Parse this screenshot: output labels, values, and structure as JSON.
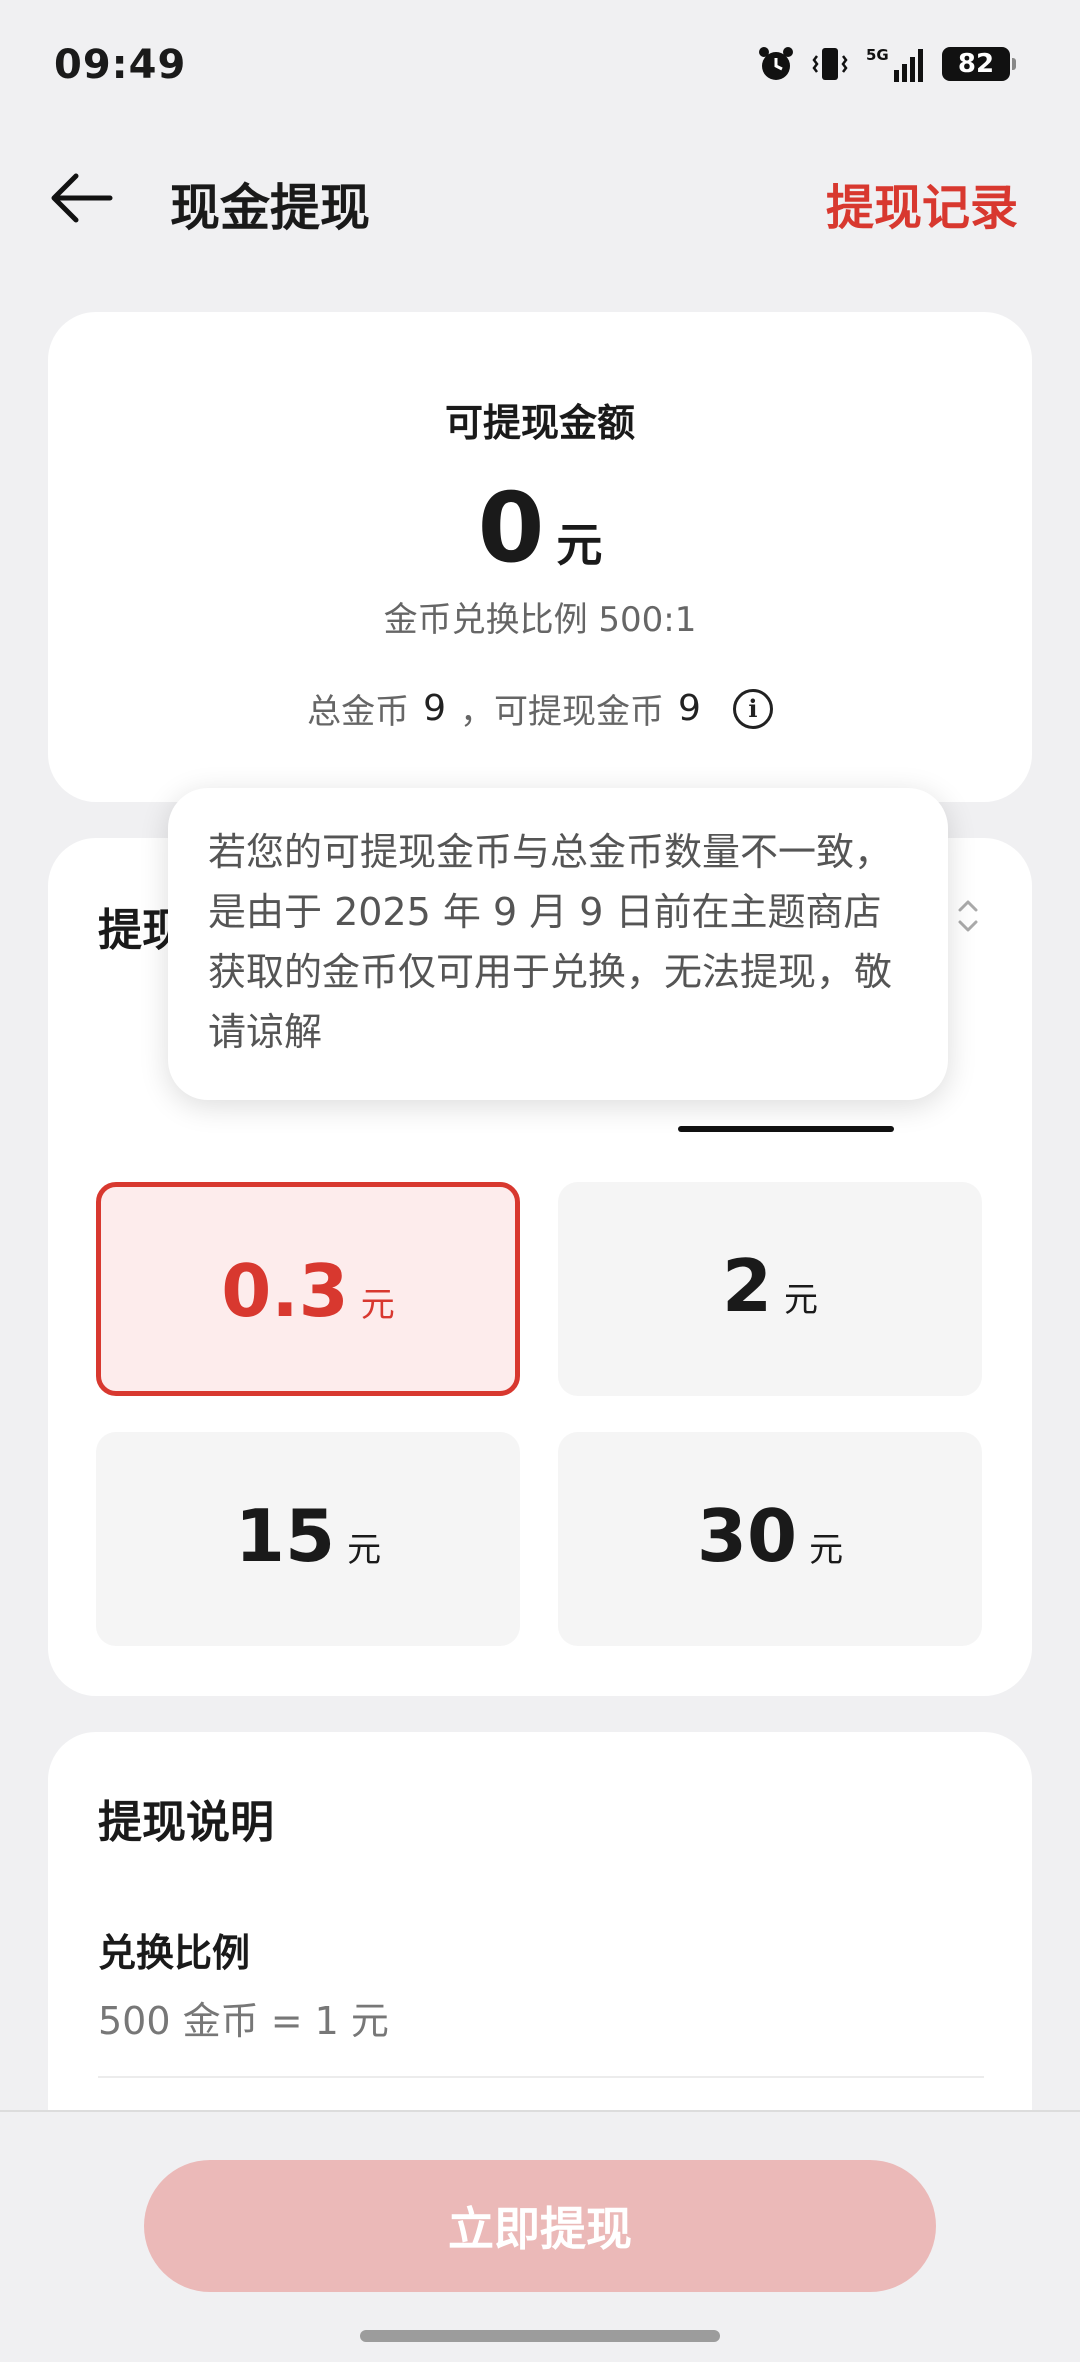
{
  "status": {
    "time": "09:49",
    "network": "5G",
    "battery": "82"
  },
  "header": {
    "title": "现金提现",
    "records": "提现记录"
  },
  "summary": {
    "label": "可提现金额",
    "amount": "0",
    "unit": "元",
    "ratio_text": "金币兑换比例 500:1",
    "total_label": "总金币",
    "total_value": "9",
    "separator": "，",
    "withdrawable_label": "可提现金币",
    "withdrawable_value": "9",
    "info_glyph": "i"
  },
  "tooltip": {
    "text": "若您的可提现金币与总金币数量不一致，是由于 2025 年 9 月 9 日前在主题商店获取的金币仅可用于兑换，无法提现，敬请谅解"
  },
  "withdraw": {
    "title": "提现",
    "options": [
      {
        "amount": "0.3",
        "unit": "元",
        "selected": true
      },
      {
        "amount": "2",
        "unit": "元",
        "selected": false
      },
      {
        "amount": "15",
        "unit": "元",
        "selected": false
      },
      {
        "amount": "30",
        "unit": "元",
        "selected": false
      }
    ]
  },
  "instructions": {
    "title": "提现说明",
    "items": [
      {
        "label": "兑换比例",
        "value": "500 金币 = 1 元"
      }
    ]
  },
  "action": {
    "submit_label": "立即提现"
  },
  "colors": {
    "accent": "#d8382f",
    "accent_light": "#fdecec",
    "button_disabled": "#ebb9b8",
    "background": "#f0f0f2"
  }
}
